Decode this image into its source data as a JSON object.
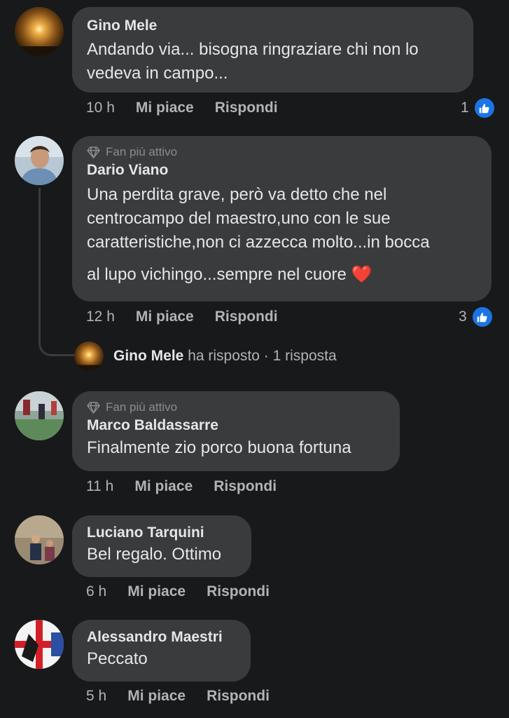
{
  "comments": [
    {
      "name": "Gino Mele",
      "badge": "",
      "lines": [
        "Andando via... bisogna ringraziare chi non lo",
        "vedeva in campo..."
      ],
      "time": "10 h",
      "like_label": "Mi piace",
      "reply_label": "Rispondi",
      "reactions": "1",
      "avatar_icon": "sunset-avatar"
    },
    {
      "name": "Dario Viano",
      "badge": "Fan più attivo",
      "lines": [
        "Una perdita grave, però va detto che nel",
        "centrocampo del maestro,uno con le sue",
        "caratteristiche,non ci azzecca molto...in bocca",
        "al lupo vichingo...sempre nel cuore"
      ],
      "emoji": "❤️",
      "time": "12 h",
      "like_label": "Mi piace",
      "reply_label": "Rispondi",
      "reactions": "3",
      "avatar_icon": "person-avatar"
    },
    {
      "name": "Marco Baldassarre",
      "badge": "Fan più attivo",
      "lines": [
        "Finalmente zio porco buona fortuna"
      ],
      "time": "11 h",
      "like_label": "Mi piace",
      "reply_label": "Rispondi",
      "avatar_icon": "soccer-avatar"
    },
    {
      "name": "Luciano Tarquini",
      "badge": "",
      "lines": [
        "Bel regalo. Ottimo"
      ],
      "time": "6 h",
      "like_label": "Mi piace",
      "reply_label": "Rispondi",
      "avatar_icon": "group-avatar"
    },
    {
      "name": "Alessandro Maestri",
      "badge": "",
      "lines": [
        "Peccato"
      ],
      "time": "5 h",
      "like_label": "Mi piace",
      "reply_label": "Rispondi",
      "avatar_icon": "flag-avatar"
    }
  ],
  "reply_summary": {
    "name": "Gino Mele",
    "action": "ha risposto",
    "separator": "·",
    "count": "1 risposta"
  },
  "colors": {
    "background": "#18191a",
    "bubble": "#3a3b3c",
    "like_blue": "#1b74e4",
    "muted_text": "#b0b3b8"
  }
}
